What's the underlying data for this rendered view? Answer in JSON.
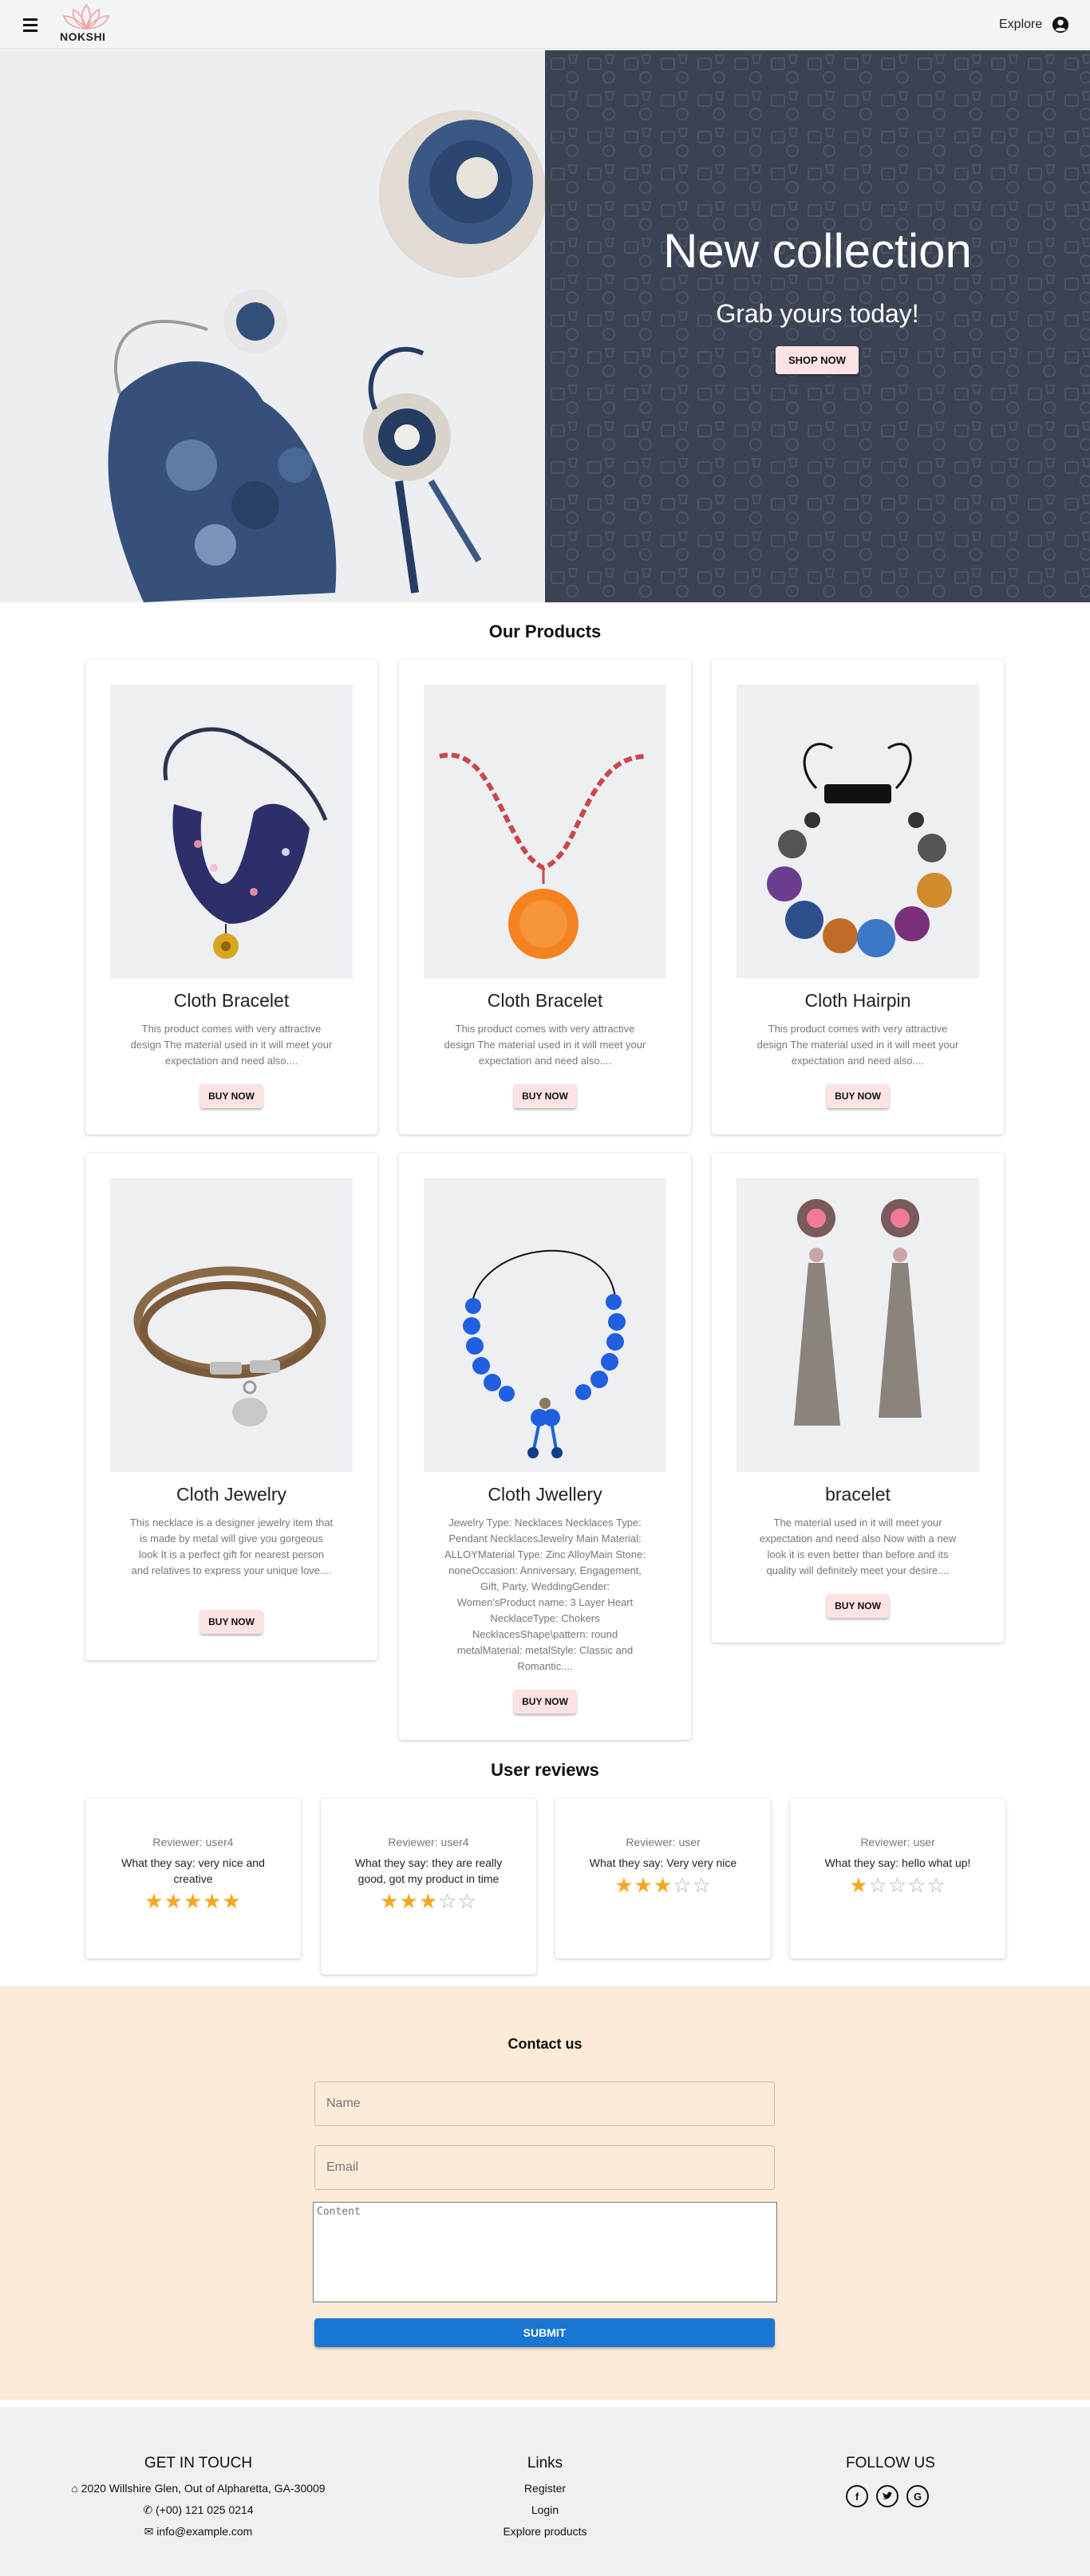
{
  "app": {
    "brand": "NOKSHI",
    "explore_label": "Explore"
  },
  "hero": {
    "title": "New collection",
    "subtitle": "Grab yours today!",
    "cta_label": "SHOP NOW"
  },
  "products_section": {
    "title": "Our Products",
    "products": [
      {
        "name": "Cloth Bracelet",
        "description": "This product comes with very attractive design The material used in it will meet your expectation and need also....",
        "buy_label": "BUY NOW"
      },
      {
        "name": "Cloth Bracelet",
        "description": "This product comes with very attractive design The material used in it will meet your expectation and need also....",
        "buy_label": "BUY NOW"
      },
      {
        "name": "Cloth Hairpin",
        "description": "This product comes with very attractive design The material used in it will meet your expectation and need also....",
        "buy_label": "BUY NOW"
      },
      {
        "name": "Cloth Jewelry",
        "description": "This necklace is a designer jewelry item that is made by metal will give you gorgeous look It is a perfect gift for nearest person and relatives to express your unique love....",
        "buy_label": "BUY NOW"
      },
      {
        "name": "Cloth Jwellery",
        "description": "Jewelry Type: Necklaces Necklaces Type: Pendant NecklacesJewelry Main Material: ALLOYMaterial Type: Zinc AlloyMain Stone: noneOccasion: Anniversary, Engagement, Gift, Party, WeddingGender: Women'sProduct name: 3 Layer Heart NecklaceType: Chokers NecklacesShape\\pattern: round metalMaterial: metalStyle: Classic and Romantic....",
        "buy_label": "BUY NOW"
      },
      {
        "name": "bracelet",
        "description": "The material used in it will meet your expectation and need also Now with a new look it is even better than before and its quality will definitely meet your desire....",
        "buy_label": "BUY NOW"
      }
    ]
  },
  "reviews_section": {
    "title": "User reviews",
    "reviews": [
      {
        "reviewer": "Reviewer: user4",
        "text": "What they say: very nice and creative",
        "rating": 5
      },
      {
        "reviewer": "Reviewer: user4",
        "text": "What they say: they are really good, got my product in time",
        "rating": 3
      },
      {
        "reviewer": "Reviewer: user",
        "text": "What they say: Very very nice",
        "rating": 3
      },
      {
        "reviewer": "Reviewer: user",
        "text": "What they say: hello what up!",
        "rating": 1
      }
    ]
  },
  "contact": {
    "title": "Contact us",
    "name_placeholder": "Name",
    "email_placeholder": "Email",
    "content_placeholder": "Content",
    "submit_label": "SUBMIT"
  },
  "footer": {
    "get_in_touch": {
      "title": "GET IN TOUCH",
      "address": "2020 Willshire Glen, Out of Alpharetta, GA-30009",
      "phone": "(+00) 121 025 0214",
      "email": "info@example.com"
    },
    "links": {
      "title": "Links",
      "items": [
        "Register",
        "Login",
        "Explore products"
      ]
    },
    "follow": {
      "title": "FOLLOW US",
      "icons": [
        "facebook-icon",
        "twitter-icon",
        "google-icon"
      ]
    }
  },
  "colors": {
    "hero_dark": "#3b4353",
    "button_pink": "#fbe3e3",
    "contact_bg": "#fcebd7",
    "submit_blue": "#1976d2",
    "star": "#f5a623"
  }
}
